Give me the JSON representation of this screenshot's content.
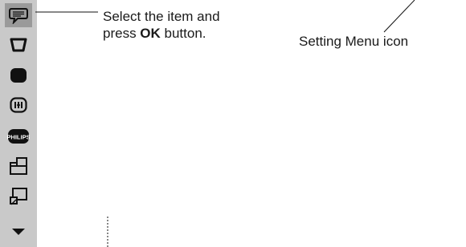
{
  "callout": {
    "line1": "Select the item and",
    "line2_prefix": "press ",
    "line2_bold": "OK",
    "line2_suffix": " button."
  },
  "menu_icon_label": {
    "bold": "Setting Menu",
    "suffix": " icon"
  },
  "sidebar": {
    "items": [
      {
        "icon": "speech-bubble-icon",
        "selected": true
      },
      {
        "icon": "trapezoid-screen-icon"
      },
      {
        "icon": "filled-screen-icon"
      },
      {
        "icon": "info-screen-icon"
      },
      {
        "icon": "philips-logo-icon",
        "text": "PHILIPS"
      },
      {
        "icon": "stacked-windows-icon"
      },
      {
        "icon": "picture-in-picture-icon"
      },
      {
        "icon": "arrow-down-icon"
      }
    ]
  },
  "colors": {
    "sidebar_bg": "#c9c9c9",
    "selected_bg": "#9a9a9a",
    "icon": "#111111"
  }
}
